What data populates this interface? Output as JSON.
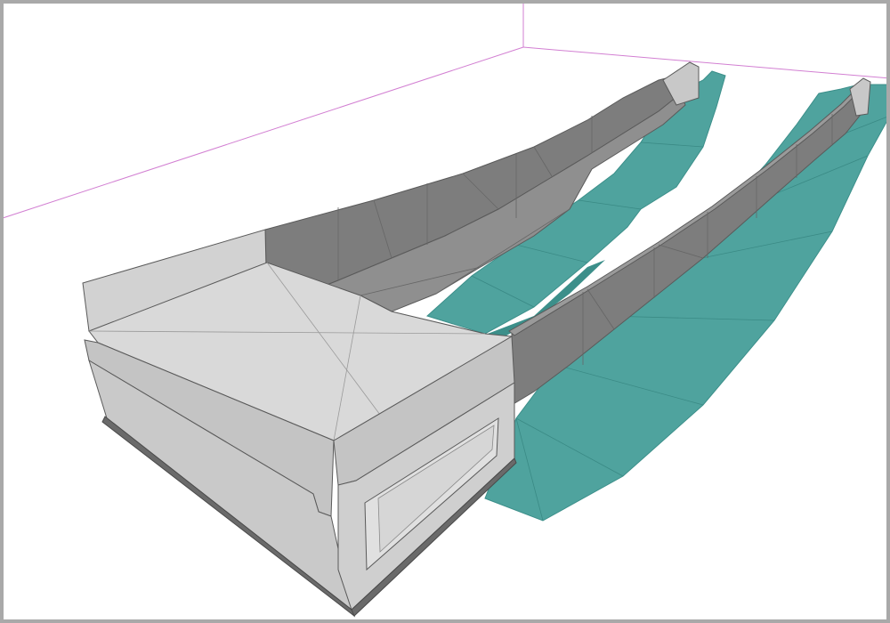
{
  "viewport": {
    "background": "#ffffff",
    "frame_color": "#a9a9a9"
  },
  "colors": {
    "grid_lines": "#d27fd2",
    "channel_floor": "#4fa39e",
    "channel_floor_dark": "#3c8f8a",
    "wall_dark": "#7d7d7d",
    "wall_mid": "#8f8f8f",
    "culvert_light": "#d9d9d9",
    "culvert_face": "#c4c4c4",
    "edge_lines": "#5a5a5a"
  },
  "scene": {
    "object": "3d-model-box-culvert-with-curved-retaining-walls",
    "components": [
      "box-culvert",
      "left-retaining-wall",
      "right-retaining-wall",
      "channel-floor",
      "bounding-grid"
    ]
  }
}
